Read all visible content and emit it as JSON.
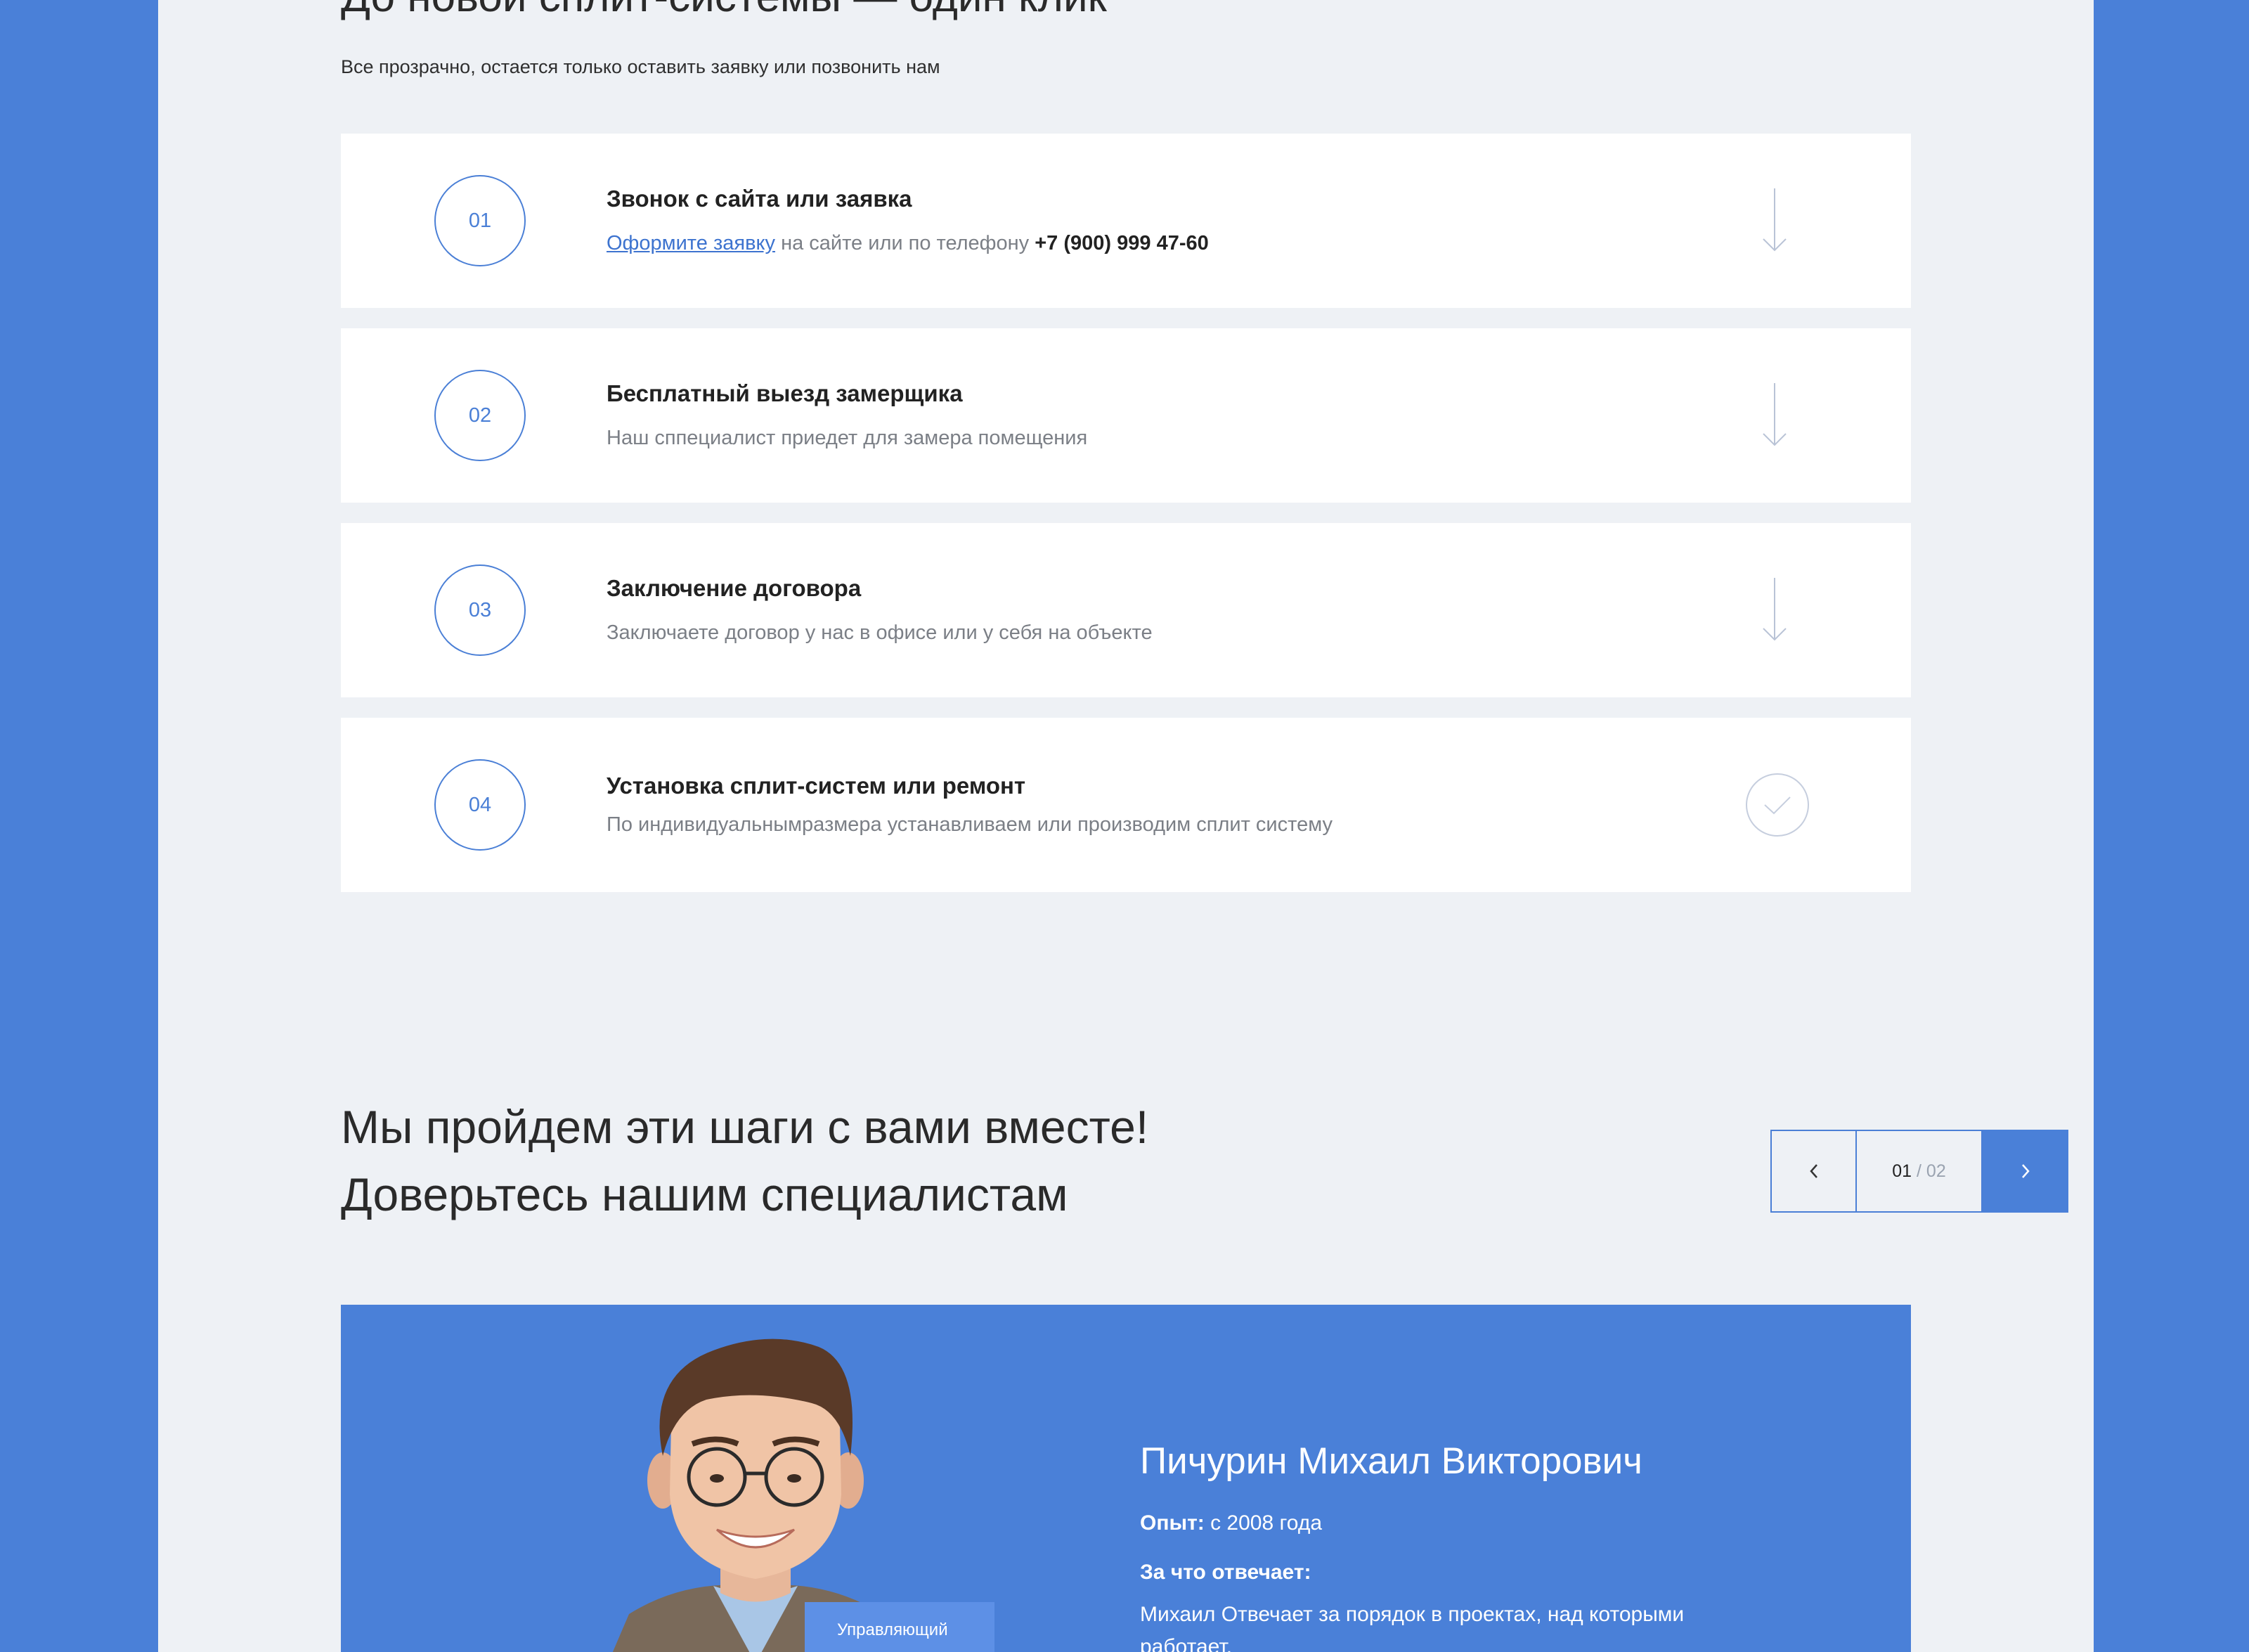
{
  "process": {
    "title": "До новой сплит-системы — один клик",
    "subtitle": "Все прозрачно, остается только оставить заявку или позвонить нам",
    "steps": [
      {
        "num": "01",
        "title": "Звонок с сайта или заявка",
        "link": "Оформите заявку",
        "desc": " на сайте или по телефону ",
        "phone": "+7 (900) 999 47-60",
        "icon": "arrow-down-icon"
      },
      {
        "num": "02",
        "title": "Бесплатный выезд замерщика",
        "desc": "Наш сппециалист приедет для замера помещения",
        "icon": "arrow-down-icon"
      },
      {
        "num": "03",
        "title": "Заключение договора",
        "desc": "Заключаете договор у нас в офисе или у себя на объекте",
        "icon": "arrow-down-icon"
      },
      {
        "num": "04",
        "title": "Установка сплит-систем или ремонт",
        "desc": "По индивидуальнымразмера устанавливаем или производим сплит систему",
        "icon": "check-circle-icon"
      }
    ]
  },
  "team": {
    "title_line1": "Мы пройдем эти шаги с вами вместе!",
    "title_line2": "Доверьтесь нашим специалистам",
    "pager": {
      "current": "01",
      "separator": " / ",
      "total": "02"
    },
    "expert": {
      "name": "Пичурин Михаил Викторович",
      "experience_label": "Опыт:",
      "experience_value": " с 2008 года",
      "responsibility_label": "За что отвечает:",
      "responsibility_text": "Михаил Отвечает за порядок в проектах, над которыми работает.",
      "role": "Управляющий"
    }
  },
  "colors": {
    "accent": "#4a80d8",
    "page_bg": "#eef1f5",
    "card_bg": "#ffffff"
  }
}
